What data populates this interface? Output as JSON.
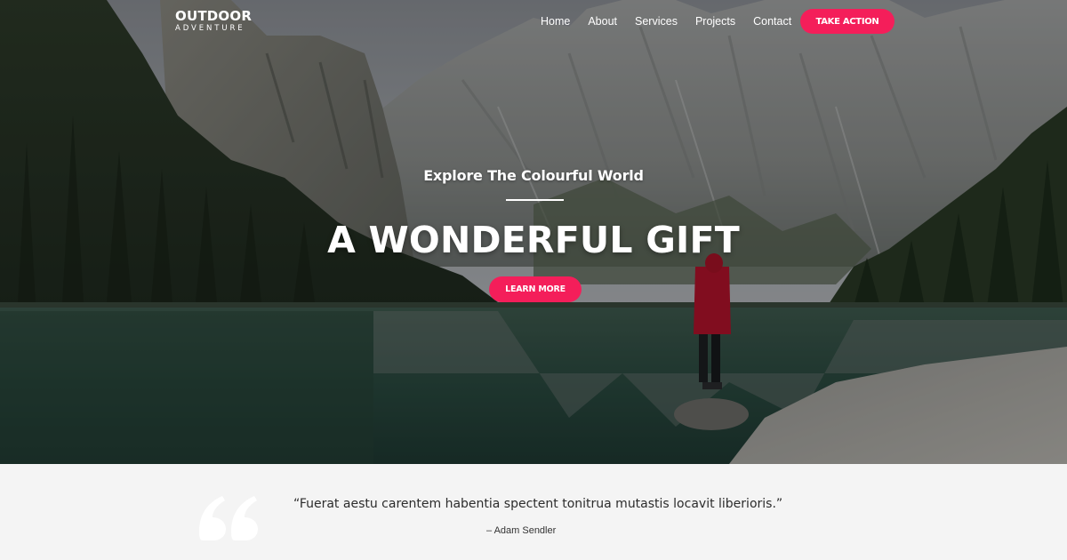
{
  "header": {
    "logo": {
      "title": "OUTDOOR",
      "subtitle": "ADVENTURE"
    },
    "nav": [
      {
        "label": "Home"
      },
      {
        "label": "About"
      },
      {
        "label": "Services"
      },
      {
        "label": "Projects"
      },
      {
        "label": "Contact"
      }
    ],
    "cta_label": "TAKE ACTION"
  },
  "hero": {
    "subtitle": "Explore The Colourful World",
    "title": "A WONDERFUL GIFT",
    "button_label": "LEARN MORE",
    "background_scene": "mountain-lake-hiker-photo"
  },
  "testimonial": {
    "quote": "“Fuerat aestu carentem habentia spectent tonitrua mutastis locavit liberioris.”",
    "author": "– Adam Sendler",
    "icon": "quote-icon"
  },
  "colors": {
    "accent": "#f41e5a",
    "testimonial_bg": "#f4f4f4",
    "text_dark": "#2c2c2c"
  }
}
